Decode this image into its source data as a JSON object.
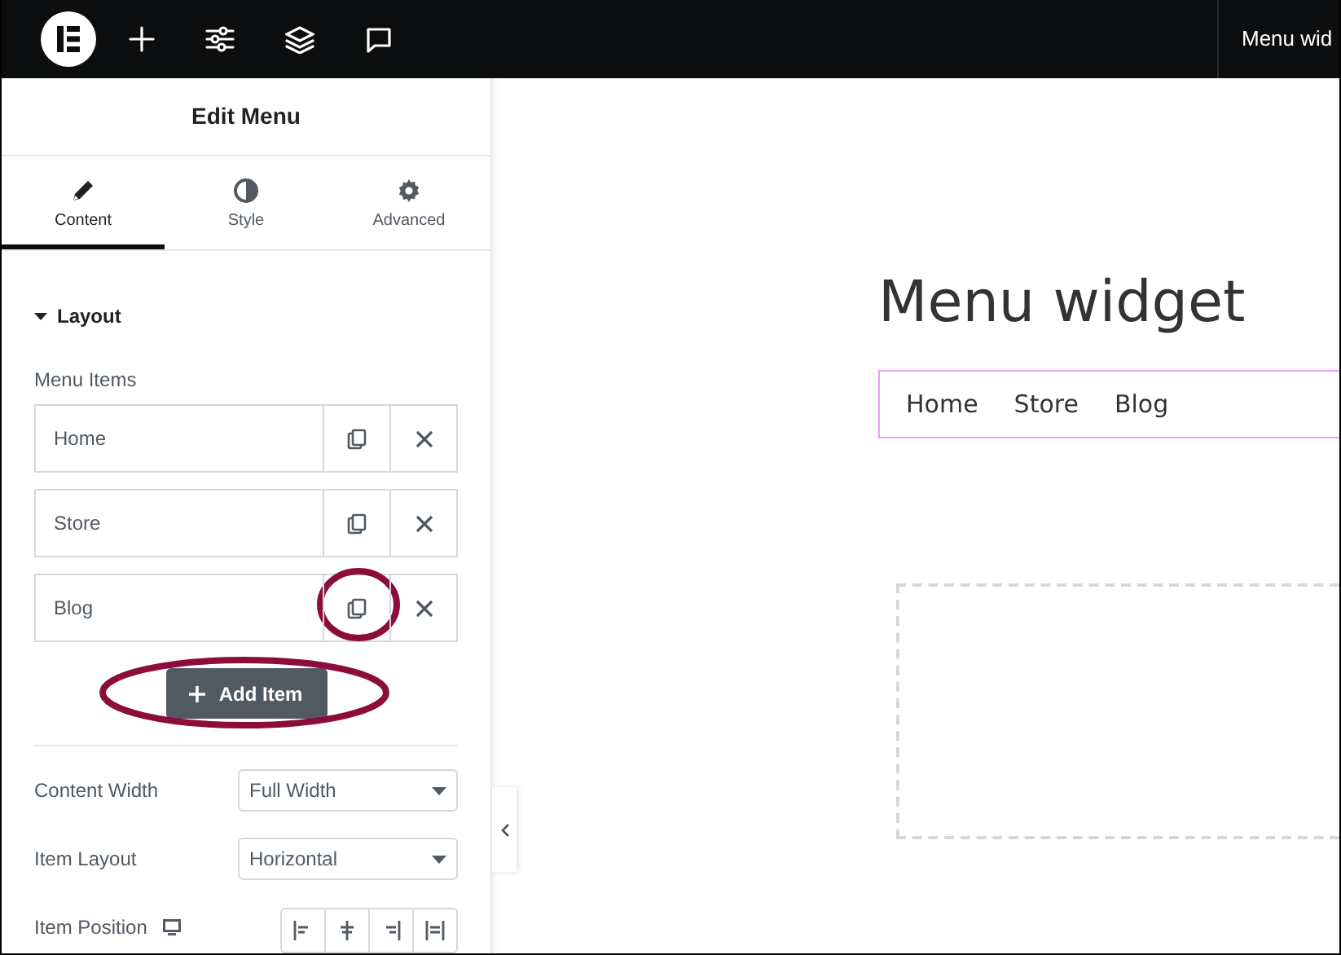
{
  "top_bar": {
    "title": "Menu wid"
  },
  "panel": {
    "title": "Edit Menu",
    "tabs": [
      {
        "label": "Content",
        "selected": true
      },
      {
        "label": "Style",
        "selected": false
      },
      {
        "label": "Advanced",
        "selected": false
      }
    ],
    "section": {
      "title": "Layout",
      "expanded": true
    },
    "repeater": {
      "label": "Menu Items",
      "items": [
        {
          "label": "Home",
          "copy_highlighted": false
        },
        {
          "label": "Store",
          "copy_highlighted": false
        },
        {
          "label": "Blog",
          "copy_highlighted": true
        }
      ]
    },
    "add_button": {
      "label": "Add Item",
      "highlighted": true
    },
    "controls": [
      {
        "kind": "select",
        "label": "Content Width",
        "value": "Full Width"
      },
      {
        "kind": "select",
        "label": "Item Layout",
        "value": "Horizontal"
      },
      {
        "kind": "align",
        "label": "Item Position",
        "responsive": true
      }
    ]
  },
  "canvas": {
    "heading": "Menu widget",
    "nav": [
      {
        "label": "Home"
      },
      {
        "label": "Store"
      },
      {
        "label": "Blog"
      }
    ]
  }
}
